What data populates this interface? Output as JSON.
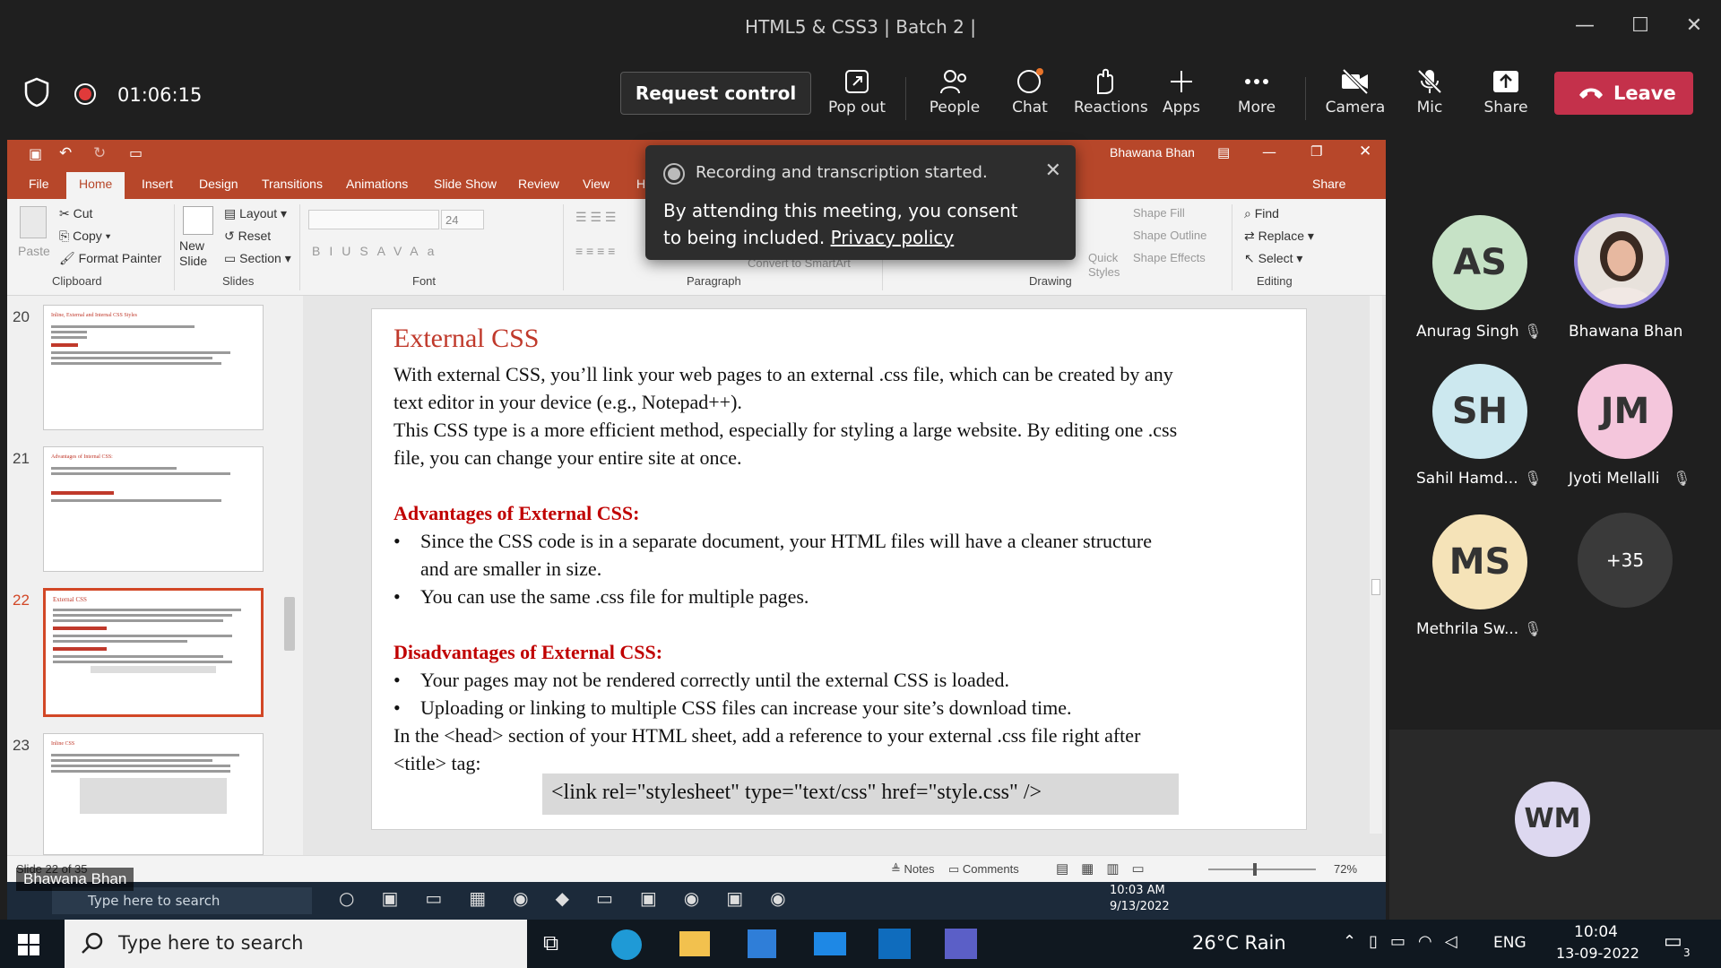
{
  "window": {
    "title": "HTML5 & CSS3 | Batch 2 |"
  },
  "meeting": {
    "timer": "01:06:15",
    "request_control": "Request control",
    "buttons": [
      "Pop out",
      "People",
      "Chat",
      "Reactions",
      "Apps",
      "More",
      "Camera",
      "Mic",
      "Share"
    ],
    "leave": "Leave"
  },
  "notification": {
    "status": "Recording and transcription started.",
    "message": "By attending this meeting, you consent to being included.",
    "link": "Privacy policy"
  },
  "ppt": {
    "user": "Bhawana Bhan",
    "share": "Share",
    "tabs": [
      "File",
      "Home",
      "Insert",
      "Design",
      "Transitions",
      "Animations",
      "Slide Show",
      "Review",
      "View",
      "H"
    ],
    "ribbon": {
      "clipboard": {
        "paste": "Paste",
        "cut": "Cut",
        "copy": "Copy",
        "format_painter": "Format Painter",
        "label": "Clipboard"
      },
      "slides": {
        "new_slide": "New Slide",
        "layout": "Layout",
        "reset": "Reset",
        "section": "Section",
        "label": "Slides"
      },
      "font": {
        "size": "24",
        "label": "Font"
      },
      "paragraph": {
        "convert": "Convert to SmartArt",
        "label": "Paragraph"
      },
      "drawing": {
        "shape_fill": "Shape Fill",
        "shape_outline": "Shape Outline",
        "shape_effects": "Shape Effects",
        "quick_styles": "Quick Styles",
        "label": "Drawing"
      },
      "editing": {
        "find": "Find",
        "replace": "Replace",
        "select": "Select",
        "label": "Editing"
      }
    },
    "thumbnails": [
      {
        "num": "20",
        "title": "Inline, External and Internal CSS Styles"
      },
      {
        "num": "21",
        "title": "Advantages of Internal CSS:"
      },
      {
        "num": "22",
        "title": "External CSS"
      },
      {
        "num": "23",
        "title": "Inline CSS"
      }
    ],
    "slide": {
      "title": "External CSS",
      "p1a": "With external CSS, you’ll link your web pages to an external .css file, which can be created by any",
      "p1b": "text editor in your device (e.g., Notepad++).",
      "p2a": "This CSS type is a more efficient method, especially for styling a large website. By editing one .css",
      "p2b": "file, you can change your entire site at once.",
      "adv_heading": "Advantages of External CSS:",
      "adv1a": "Since the CSS code is in a separate document, your HTML files will have a cleaner structure",
      "adv1b": "and are smaller in size.",
      "adv2": "You can use the same .css file for multiple pages.",
      "dis_heading": "Disadvantages of External CSS:",
      "dis1": "Your pages may not be rendered correctly until the external CSS is loaded.",
      "dis2": "Uploading or linking to multiple CSS files can increase your site’s download time.",
      "p3a": "In the <head> section of your HTML sheet, add a reference to your external .css file right after",
      "p3b": "<title> tag:",
      "code": "<link rel=\"stylesheet\" type=\"text/css\" href=\"style.css\" />",
      "bullet": "•"
    },
    "status": {
      "slide": "Slide 22 of 35",
      "notes": "Notes",
      "comments": "Comments",
      "zoom": "72%"
    },
    "inner_taskbar": {
      "search": "Type here to search",
      "time": "10:03 AM",
      "date": "9/13/2022"
    }
  },
  "presenter_badge": "Bhawana Bhan",
  "participants": [
    {
      "initials": "AS",
      "name": "Anurag Singh",
      "color": "#c6e2c6"
    },
    {
      "initials": "",
      "name": "Bhawana Bhan",
      "color": "#8a7bd8"
    },
    {
      "initials": "SH",
      "name": "Sahil Hamd...",
      "color": "#cce8ef"
    },
    {
      "initials": "JM",
      "name": "Jyoti Mellalli",
      "color": "#f4c6dc"
    },
    {
      "initials": "MS",
      "name": "Methrila Sw...",
      "color": "#f5e3b8"
    },
    {
      "initials": "+35",
      "name": "",
      "color": "#3a3a3a"
    },
    {
      "initials": "WM",
      "name": "",
      "color": "#ddd8f0"
    }
  ],
  "taskbar": {
    "search": "Type here to search",
    "weather": "26°C  Rain",
    "lang": "ENG",
    "time": "10:04",
    "date": "13-09-2022",
    "notif_count": "3"
  }
}
